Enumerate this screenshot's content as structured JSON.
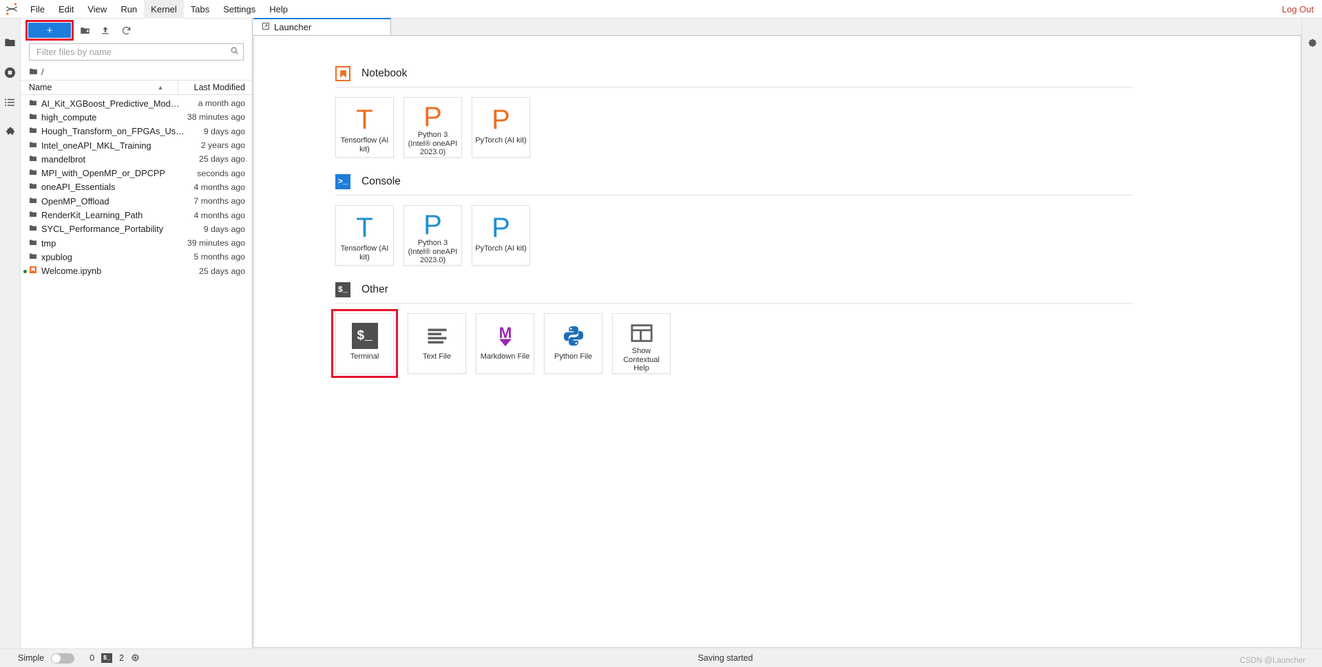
{
  "menubar": {
    "logo": "jupyter-logo",
    "items": [
      {
        "label": "File",
        "active": false
      },
      {
        "label": "Edit",
        "active": false
      },
      {
        "label": "View",
        "active": false
      },
      {
        "label": "Run",
        "active": false
      },
      {
        "label": "Kernel",
        "active": true
      },
      {
        "label": "Tabs",
        "active": false
      },
      {
        "label": "Settings",
        "active": false
      },
      {
        "label": "Help",
        "active": false
      }
    ],
    "logout_label": "Log Out"
  },
  "activitybar": {
    "items": [
      {
        "name": "file-browser-icon",
        "glyph": "folder"
      },
      {
        "name": "running-terminals-icon",
        "glyph": "stop"
      },
      {
        "name": "table-of-contents-icon",
        "glyph": "list"
      },
      {
        "name": "extension-manager-icon",
        "glyph": "puzzle"
      }
    ]
  },
  "filebrowser": {
    "toolbar": {
      "new_launcher_label": "+",
      "new_folder_icon": "new-folder-icon",
      "upload_icon": "upload-icon",
      "refresh_icon": "refresh-icon",
      "highlight_color": "#e8112d",
      "new_launcher_color": "#1e7ddb"
    },
    "filter": {
      "placeholder": "Filter files by name",
      "value": "",
      "icon": "search-icon"
    },
    "breadcrumb": {
      "icon": "folder-icon",
      "path": "/"
    },
    "columns": {
      "name": "Name",
      "last_modified": "Last Modified"
    },
    "sort": {
      "column": "Name",
      "direction": "ascending"
    },
    "rows": [
      {
        "name": "AI_Kit_XGBoost_Predictive_Modeling",
        "modified": "a month ago",
        "type": "folder",
        "running": false
      },
      {
        "name": "high_compute",
        "modified": "38 minutes ago",
        "type": "folder",
        "running": false
      },
      {
        "name": "Hough_Transform_on_FPGAs_Using_on...",
        "modified": "9 days ago",
        "type": "folder",
        "running": false
      },
      {
        "name": "Intel_oneAPI_MKL_Training",
        "modified": "2 years ago",
        "type": "folder",
        "running": false
      },
      {
        "name": "mandelbrot",
        "modified": "25 days ago",
        "type": "folder",
        "running": false
      },
      {
        "name": "MPI_with_OpenMP_or_DPCPP",
        "modified": "seconds ago",
        "type": "folder",
        "running": false
      },
      {
        "name": "oneAPI_Essentials",
        "modified": "4 months ago",
        "type": "folder",
        "running": false
      },
      {
        "name": "OpenMP_Offload",
        "modified": "7 months ago",
        "type": "folder",
        "running": false
      },
      {
        "name": "RenderKit_Learning_Path",
        "modified": "4 months ago",
        "type": "folder",
        "running": false
      },
      {
        "name": "SYCL_Performance_Portability",
        "modified": "9 days ago",
        "type": "folder",
        "running": false
      },
      {
        "name": "tmp",
        "modified": "39 minutes ago",
        "type": "folder",
        "running": false
      },
      {
        "name": "xpublog",
        "modified": "5 months ago",
        "type": "folder",
        "running": false
      },
      {
        "name": "Welcome.ipynb",
        "modified": "25 days ago",
        "type": "notebook",
        "running": true
      }
    ]
  },
  "dock": {
    "tabs": [
      {
        "label": "Launcher",
        "icon": "launcher-icon",
        "active": true
      }
    ]
  },
  "launcher": {
    "sections": [
      {
        "title": "Notebook",
        "icon": "notebook-icon",
        "icon_color": "#ee6f22",
        "cards": [
          {
            "label": "Tensorflow (AI kit)",
            "glyph": "T",
            "color": "#ee6f22",
            "highlighted": false
          },
          {
            "label": "Python 3 (Intel® oneAPI 2023.0)",
            "glyph": "P",
            "color": "#ee6f22",
            "highlighted": false
          },
          {
            "label": "PyTorch (AI kit)",
            "glyph": "P",
            "color": "#ee6f22",
            "highlighted": false
          }
        ]
      },
      {
        "title": "Console",
        "icon": "console-icon",
        "icon_color": "#1e7ddb",
        "cards": [
          {
            "label": "Tensorflow (AI kit)",
            "glyph": "T",
            "color": "#1f8fd6",
            "highlighted": false
          },
          {
            "label": "Python 3 (Intel® oneAPI 2023.0)",
            "glyph": "P",
            "color": "#1f8fd6",
            "highlighted": false
          },
          {
            "label": "PyTorch (AI kit)",
            "glyph": "P",
            "color": "#1f8fd6",
            "highlighted": false
          }
        ]
      },
      {
        "title": "Other",
        "icon": "terminal-icon",
        "icon_color": "#4f4f4f",
        "cards": [
          {
            "label": "Terminal",
            "glyph": "$_",
            "color": "#4f4f4f",
            "highlighted": true
          },
          {
            "label": "Text File",
            "glyph": "text-file-icon",
            "color": "#616161",
            "highlighted": false
          },
          {
            "label": "Markdown File",
            "glyph": "markdown-icon",
            "color": "#9b27b0",
            "highlighted": false
          },
          {
            "label": "Python File",
            "glyph": "python-icon",
            "color": "#1e6fb8",
            "highlighted": false
          },
          {
            "label": "Show Contextual Help",
            "glyph": "contextual-help-icon",
            "color": "#616161",
            "highlighted": false
          }
        ]
      }
    ]
  },
  "rightbar": {
    "items": [
      {
        "name": "property-inspector-icon",
        "glyph": "gear"
      }
    ]
  },
  "statusbar": {
    "mode_label": "Simple",
    "mode_enabled": false,
    "kernel_count": "0",
    "terminal_chip": "$_",
    "terminal_count": "2",
    "resource_icon": "cpu-icon",
    "message": "Saving started",
    "watermark": "CSDN @Launcher"
  }
}
